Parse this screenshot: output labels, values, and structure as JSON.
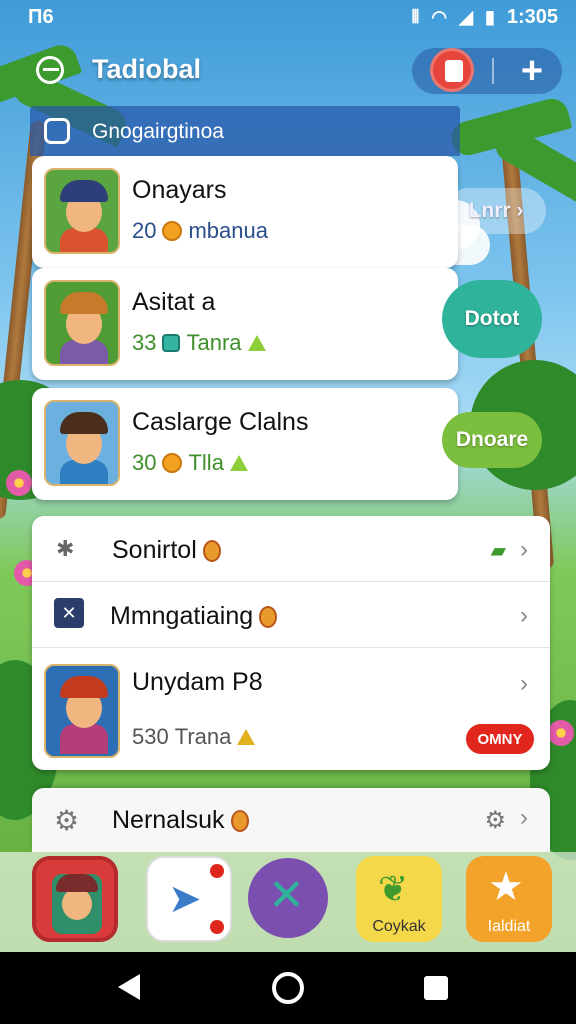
{
  "status_bar": {
    "left": "Π6",
    "time": "1:305"
  },
  "header": {
    "title": "Tadiobal"
  },
  "section": {
    "title": "Gnogairgtinoa"
  },
  "games": [
    {
      "name": "Onayars",
      "stat_value": "20",
      "stat_label": "mbanua",
      "button": "Lnrr ›"
    },
    {
      "name": "Asitat a",
      "stat_value": "33",
      "stat_label": "Tanra",
      "button": "Dotot"
    },
    {
      "name": "Caslarge Clalns",
      "stat_value": "30",
      "stat_label": "Tlla",
      "button": "Dnoare"
    }
  ],
  "menu": [
    {
      "label": "Sonirtol"
    },
    {
      "label": "Mmngatiaing"
    },
    {
      "label": "Unydam P8",
      "stat_value": "530",
      "stat_label": "Trana",
      "badge": "OMNY"
    }
  ],
  "nernal": {
    "label": "Nernalsuk"
  },
  "dock": [
    {
      "name": "hero-app",
      "label": ""
    },
    {
      "name": "map-app",
      "label": ""
    },
    {
      "name": "swords-app",
      "label": ""
    },
    {
      "name": "leaf-app",
      "label": "Coykak"
    },
    {
      "name": "star-app",
      "label": "Ialdiat"
    }
  ],
  "colors": {
    "accent_red": "#e1261d",
    "teal_button": "#2fb39b",
    "green_button": "#7cbf3e",
    "header_blue": "#2b5fa8"
  }
}
